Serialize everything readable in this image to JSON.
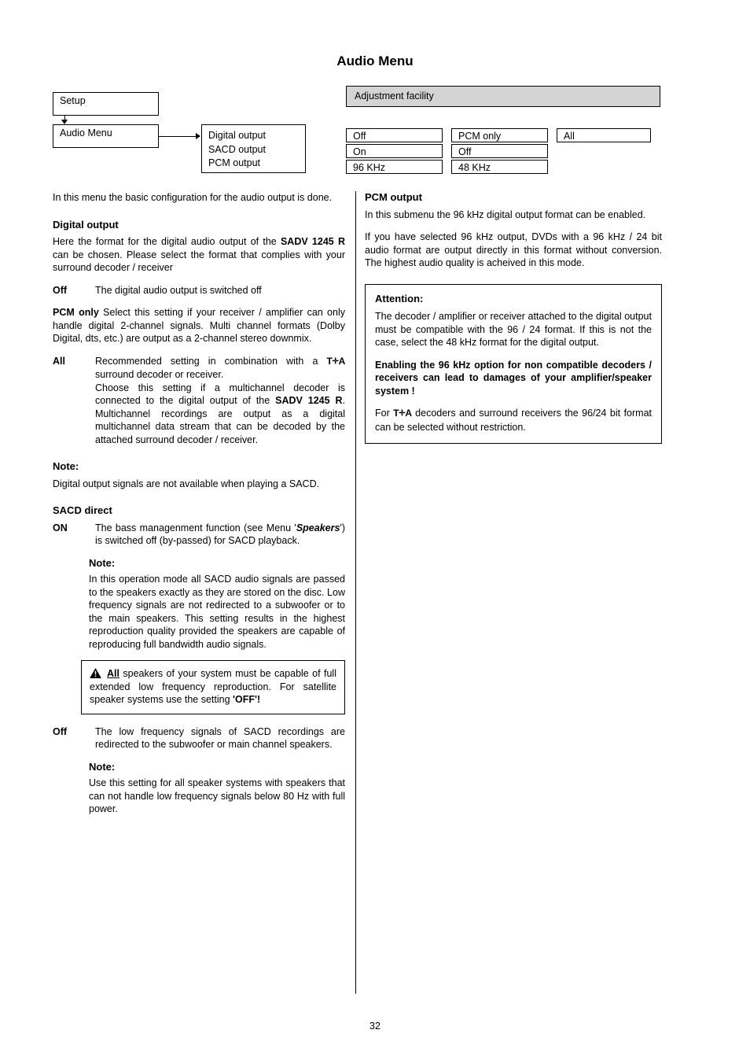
{
  "page": {
    "title": "Audio Menu",
    "number": "32"
  },
  "diagram": {
    "setup_label": "Setup",
    "audio_menu_label": "Audio Menu",
    "menu_items": [
      "Digital output",
      "SACD output",
      "PCM output"
    ],
    "adjustment_header": "Adjustment facility",
    "options": {
      "col1": [
        "Off",
        "On",
        "96 KHz"
      ],
      "col2": [
        "PCM only",
        "Off",
        "48 KHz"
      ],
      "col3": [
        "All"
      ]
    }
  },
  "left_column": {
    "intro": "In this menu the basic configuration for the audio output is done.",
    "digital_output": {
      "heading": "Digital output",
      "body_1": "Here the format for the digital audio output of the ",
      "body_model": "SADV 1245 R",
      "body_2": " can be chosen. Please select the format that complies with your surround decoder / receiver",
      "entries": [
        {
          "term": "Off",
          "desc": "The digital audio output is switched off"
        },
        {
          "term": "PCM only",
          "desc": "Select this setting if your receiver / amplifier can only handle digital 2-channel signals. Multi channel formats (Dolby Digital, dts, etc.) are output as a 2-channel stereo downmix."
        },
        {
          "term": "All",
          "desc_1": "Recommended setting in combination with a ",
          "brand": "T+A",
          "desc_2": " surround decoder or receiver.",
          "desc_3": "Choose this setting if a multichannel decoder is connected to the digital output of the ",
          "desc_model": "SADV 1245 R",
          "desc_4": ". Multichannel recordings are output as a digital multichannel data stream that can be decoded by the attached surround decoder / receiver."
        }
      ]
    },
    "note_1": {
      "heading": "Note:",
      "body": "Digital output signals are not available when playing a SACD."
    },
    "sacd_direct": {
      "heading": "SACD direct",
      "on_term": "ON",
      "on_desc_1": "The bass managenment function (see Menu '",
      "on_speakers": "Speakers",
      "on_desc_2": "') is switched off (by-passed) for SACD playback.",
      "note_heading": "Note:",
      "note_body": "In this operation mode all SACD audio signals are passed to the speakers exactly as they are stored on the disc. Low frequency signals are not redirected to a subwoofer or to the main speakers. This setting results in the highest reproduction quality provided the speakers are capable of reproducing full bandwidth audio signals.",
      "warning_1": "All",
      "warning_2": " speakers of your system must be capable of full extended low frequency reproduction. For satellite speaker systems use the setting ",
      "warning_3": "'OFF'!",
      "warning_icon": "warning-triangle-icon",
      "off_term": "Off",
      "off_desc": "The low frequency signals of SACD recordings are redirected to the subwoofer or main channel speakers.",
      "note2_heading": "Note:",
      "note2_body": "Use this setting for all speaker systems with speakers that can not handle low frequency signals below 80 Hz with full power."
    }
  },
  "right_column": {
    "pcm_output": {
      "heading": "PCM output",
      "body_1": "In this submenu the 96 kHz digital output format can be enabled.",
      "body_2": "If you have selected 96 kHz output, DVDs with a 96 kHz / 24 bit audio format are output directly in this format without conversion. The highest audio quality is acheived in this mode."
    },
    "attention": {
      "heading": "Attention:",
      "body_1": "The decoder / amplifier or receiver attached to the digital output must be compatible with the 96 / 24 format. If this is not the case, select the 48 kHz format for the digital output.",
      "body_2": "Enabling the 96 kHz option for non compatible decoders / receivers can lead to damages of your amplifier/speaker system !",
      "body_3_pre": "For ",
      "brand": "T+A",
      "body_3_post": " decoders and surround receivers the 96/24 bit format can be selected without restriction."
    }
  }
}
